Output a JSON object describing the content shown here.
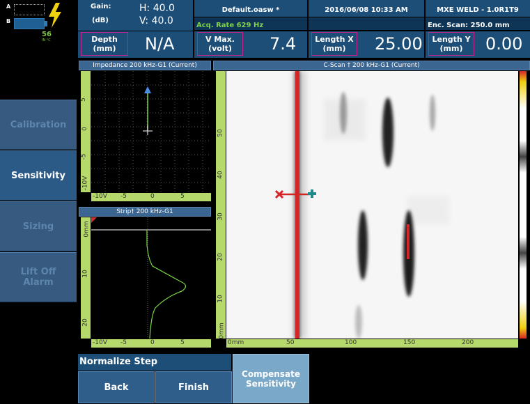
{
  "status": {
    "channel_a": "A",
    "channel_b": "B",
    "battery_value": "56",
    "battery_unit": "IN °C"
  },
  "header": {
    "gain_label": "Gain:",
    "gain_unit": "(dB)",
    "gain_h": "H: 40.0",
    "gain_v": "V: 40.0",
    "file_name": "Default.oasw *",
    "acq_rate": "Acq. Rate 629  Hz",
    "datetime": "2016/06/08 10:33 AM",
    "app_version": "MXE WELD - 1.0R1T9",
    "enc_scan": "Enc. Scan:  250.0 mm",
    "depth_label": "Depth",
    "depth_unit": "(mm)",
    "depth_value": "N/A",
    "vmax_label": "V Max.",
    "vmax_unit": "(volt)",
    "vmax_value": "7.4",
    "lengthx_label": "Length X",
    "lengthx_unit": "(mm)",
    "lengthx_value": "25.00",
    "lengthy_label": "Length Y",
    "lengthy_unit": "(mm)",
    "lengthy_value": "0.00"
  },
  "sidebar": {
    "items": [
      {
        "label": "Calibration"
      },
      {
        "label": "Sensitivity"
      },
      {
        "label": "Sizing"
      },
      {
        "label": "Lift Off Alarm"
      }
    ]
  },
  "impedance": {
    "title": "Impedance 200 kHz-G1 (Current)",
    "y_ticks": [
      "5",
      "0",
      "-5",
      "-10V"
    ],
    "x_ticks": [
      "-10V",
      "-5",
      "0",
      "5"
    ]
  },
  "strip": {
    "title": "Strip† 200 kHz-G1",
    "y_ticks": [
      "0mm",
      "10",
      "20"
    ],
    "x_ticks": [
      "-10V",
      "-5",
      "0",
      "5"
    ]
  },
  "cscan": {
    "title": "C-Scan † 200 kHz-G1 (Current)",
    "y_ticks": [
      "50",
      "40",
      "30",
      "20",
      "10",
      "0mm"
    ],
    "x_ticks": [
      "0mm",
      "50",
      "100",
      "150",
      "200"
    ]
  },
  "bottom": {
    "normalize_step": "Normalize Step",
    "back": "Back",
    "finish": "Finish",
    "compensate": "Compensate Sensitivity"
  }
}
